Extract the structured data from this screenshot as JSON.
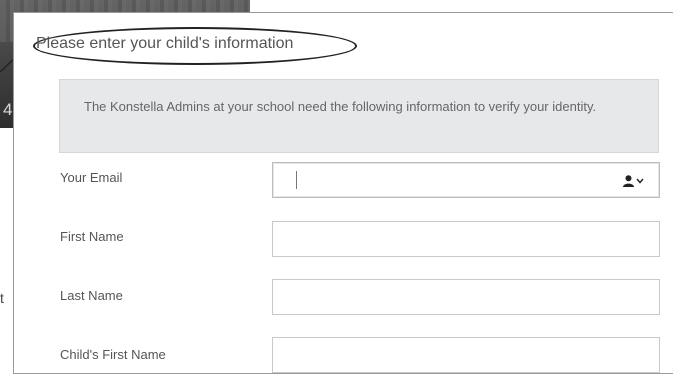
{
  "background": {
    "digit": "4",
    "text_mark": "t"
  },
  "dialog": {
    "title": "Please enter your child's information",
    "notice": "The Konstella Admins at your school need the following information to verify your identity."
  },
  "form": {
    "fields": [
      {
        "label": "Your Email",
        "value": "",
        "has_account_toggle": true
      },
      {
        "label": "First Name",
        "value": ""
      },
      {
        "label": "Last Name",
        "value": ""
      },
      {
        "label": "Child's First Name",
        "value": ""
      }
    ]
  },
  "icons": {
    "account_toggle": [
      "user-icon",
      "chevron-down-icon"
    ]
  }
}
